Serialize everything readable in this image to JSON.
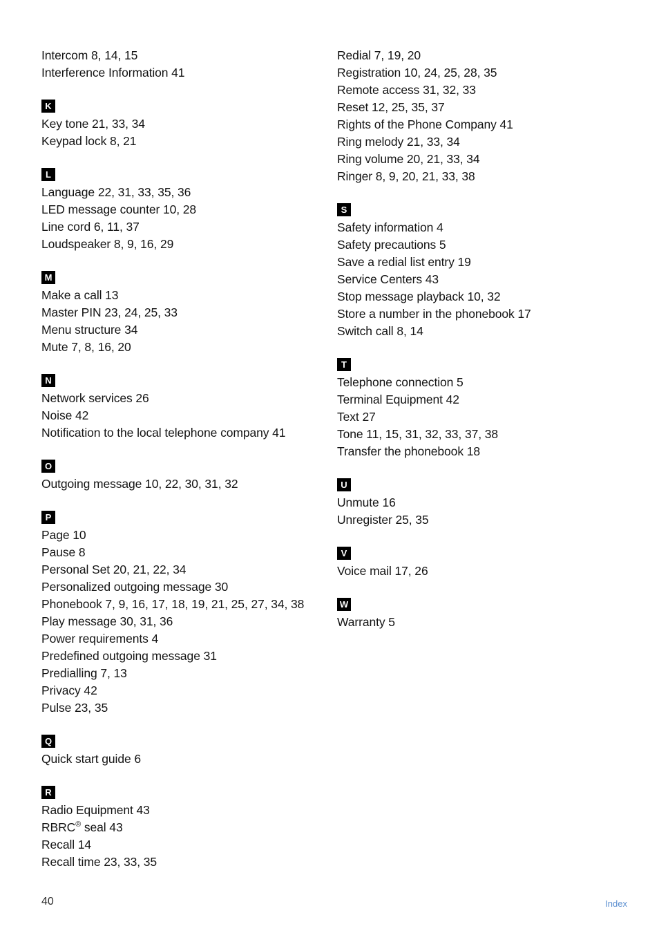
{
  "document": {
    "type": "manual-index-page",
    "page_number": "40",
    "footer_label": "Index",
    "footer_label_color": "#5b8fd0",
    "badge_background": "#000000",
    "badge_text_color": "#ffffff",
    "text_color": "#141414",
    "background": "#ffffff"
  },
  "columns": {
    "left": {
      "sections": [
        {
          "letter": "",
          "has_badge": false,
          "entries": [
            "Intercom 8, 14, 15",
            "Interference Information 41"
          ]
        },
        {
          "letter": "K",
          "has_badge": true,
          "entries": [
            "Key tone 21, 33, 34",
            "Keypad lock 8, 21"
          ]
        },
        {
          "letter": "L",
          "has_badge": true,
          "entries": [
            "Language 22, 31, 33, 35, 36",
            "LED message counter 10, 28",
            "Line cord 6, 11, 37",
            "Loudspeaker 8, 9, 16, 29"
          ]
        },
        {
          "letter": "M",
          "has_badge": true,
          "entries": [
            "Make a call 13",
            "Master PIN 23, 24, 25, 33",
            "Menu structure 34",
            "Mute 7, 8, 16, 20"
          ]
        },
        {
          "letter": "N",
          "has_badge": true,
          "entries": [
            "Network services 26",
            "Noise 42",
            "Notification to the local telephone company 41"
          ]
        },
        {
          "letter": "O",
          "has_badge": true,
          "entries": [
            "Outgoing message 10, 22, 30, 31, 32"
          ]
        },
        {
          "letter": "P",
          "has_badge": true,
          "entries": [
            "Page 10",
            "Pause 8",
            "Personal Set 20, 21, 22, 34",
            "Personalized outgoing message 30",
            "Phonebook 7, 9, 16, 17, 18, 19, 21, 25, 27, 34, 38",
            "Play message 30, 31, 36",
            "Power requirements 4",
            "Predefined outgoing message 31",
            "Predialling 7, 13",
            "Privacy 42",
            "Pulse 23, 35"
          ]
        },
        {
          "letter": "Q",
          "has_badge": true,
          "entries": [
            "Quick start guide 6"
          ]
        },
        {
          "letter": "R",
          "has_badge": true,
          "entries": [
            "Radio Equipment 43",
            "RBRC® seal 43",
            "Recall 14",
            "Recall time 23, 33, 35"
          ]
        }
      ]
    },
    "right": {
      "sections": [
        {
          "letter": "",
          "has_badge": false,
          "entries": [
            "Redial 7, 19, 20",
            "Registration 10, 24, 25, 28, 35",
            "Remote access 31, 32, 33",
            "Reset 12, 25, 35, 37",
            "Rights of the Phone Company 41",
            "Ring melody 21, 33, 34",
            "Ring volume 20, 21, 33, 34",
            "Ringer 8, 9, 20, 21, 33, 38"
          ]
        },
        {
          "letter": "S",
          "has_badge": true,
          "entries": [
            "Safety information 4",
            "Safety precautions 5",
            "Save a redial list entry 19",
            "Service Centers 43",
            "Stop message playback 10, 32",
            "Store a number in the phonebook 17",
            "Switch call 8, 14"
          ]
        },
        {
          "letter": "T",
          "has_badge": true,
          "entries": [
            "Telephone connection 5",
            "Terminal Equipment 42",
            "Text 27",
            "Tone 11, 15, 31, 32, 33, 37, 38",
            "Transfer the phonebook 18"
          ]
        },
        {
          "letter": "U",
          "has_badge": true,
          "entries": [
            "Unmute 16",
            "Unregister 25, 35"
          ]
        },
        {
          "letter": "V",
          "has_badge": true,
          "entries": [
            "Voice mail 17, 26"
          ]
        },
        {
          "letter": "W",
          "has_badge": true,
          "entries": [
            "Warranty 5"
          ]
        }
      ]
    }
  }
}
